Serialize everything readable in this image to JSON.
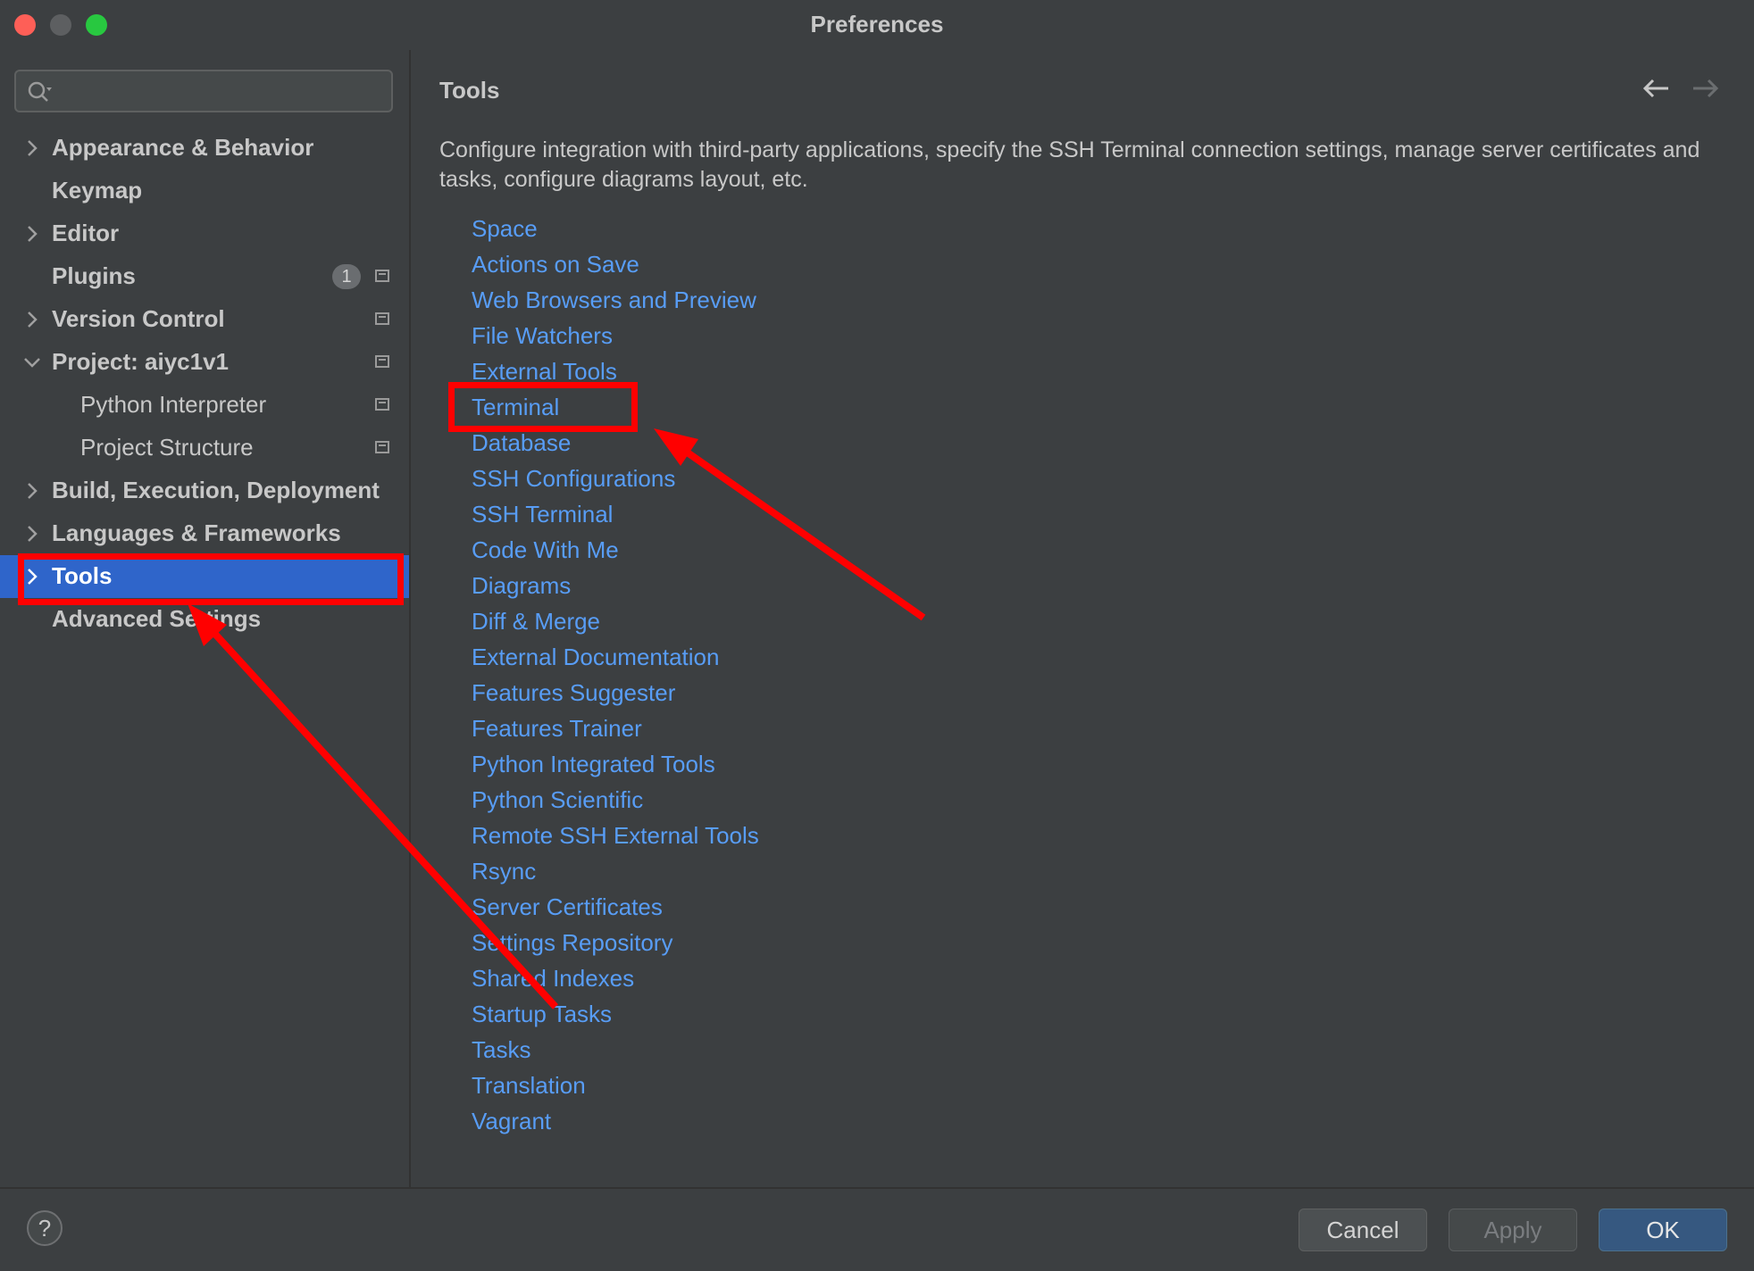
{
  "window": {
    "title": "Preferences"
  },
  "sidebar": {
    "search": {
      "placeholder": ""
    },
    "items": [
      {
        "label": "Appearance & Behavior",
        "chevron": "right"
      },
      {
        "label": "Keymap"
      },
      {
        "label": "Editor",
        "chevron": "right"
      },
      {
        "label": "Plugins",
        "badge": "1",
        "project_icon": true
      },
      {
        "label": "Version Control",
        "chevron": "right",
        "project_icon": true
      },
      {
        "label": "Project: aiyc1v1",
        "chevron": "down",
        "project_icon": true
      },
      {
        "label": "Python Interpreter",
        "indent": true,
        "project_icon": true
      },
      {
        "label": "Project Structure",
        "indent": true,
        "project_icon": true
      },
      {
        "label": "Build, Execution, Deployment",
        "chevron": "right"
      },
      {
        "label": "Languages & Frameworks",
        "chevron": "right"
      },
      {
        "label": "Tools",
        "chevron": "right",
        "selected": true
      },
      {
        "label": "Advanced Settings"
      }
    ]
  },
  "main": {
    "title": "Tools",
    "description": "Configure integration with third-party applications, specify the SSH Terminal connection settings, manage server certificates and tasks, configure diagrams layout, etc.",
    "links": [
      "Space",
      "Actions on Save",
      "Web Browsers and Preview",
      "File Watchers",
      "External Tools",
      "Terminal",
      "Database",
      "SSH Configurations",
      "SSH Terminal",
      "Code With Me",
      "Diagrams",
      "Diff & Merge",
      "External Documentation",
      "Features Suggester",
      "Features Trainer",
      "Python Integrated Tools",
      "Python Scientific",
      "Remote SSH External Tools",
      "Rsync",
      "Server Certificates",
      "Settings Repository",
      "Shared Indexes",
      "Startup Tasks",
      "Tasks",
      "Translation",
      "Vagrant"
    ]
  },
  "footer": {
    "help_label": "?",
    "cancel_label": "Cancel",
    "apply_label": "Apply",
    "ok_label": "OK"
  },
  "colors": {
    "background": "#3c3f41",
    "selection": "#2f65ca",
    "link": "#589df6",
    "annotation": "#ff0000",
    "ok_button": "#365880"
  }
}
